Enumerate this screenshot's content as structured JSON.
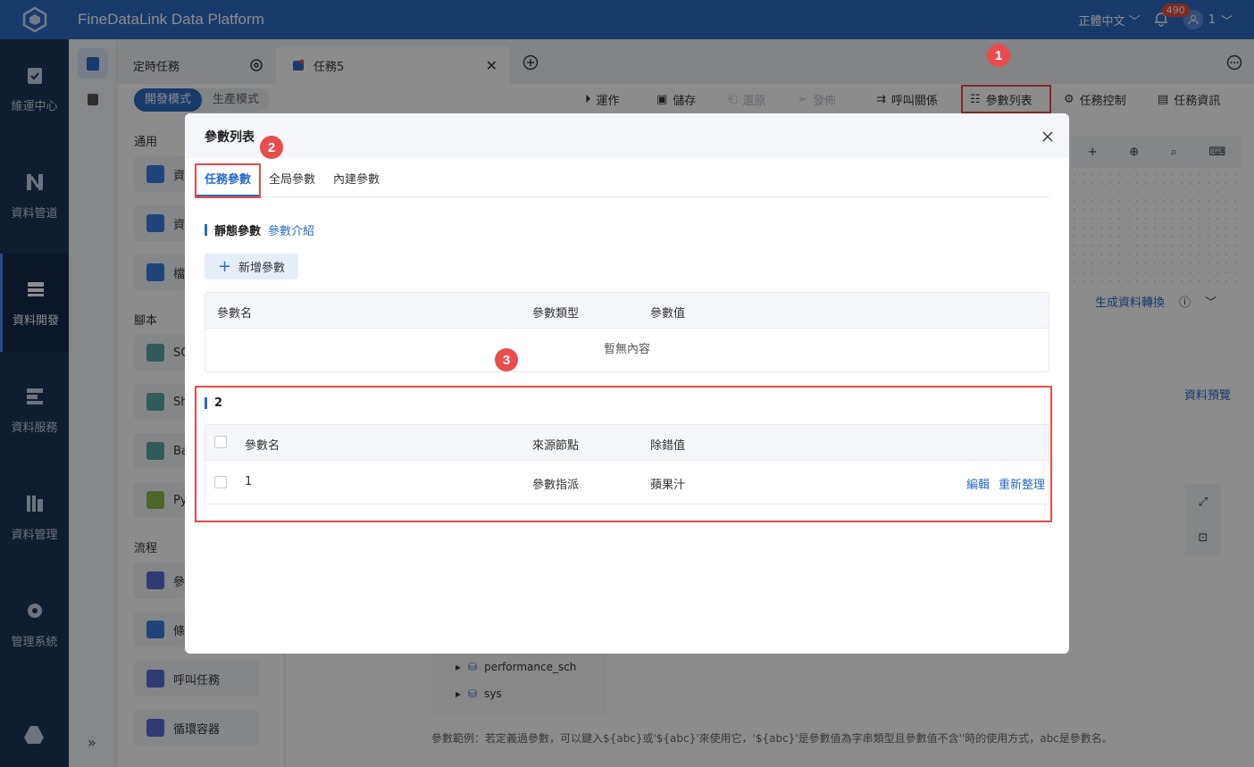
{
  "app": {
    "title": "FineDataLink Data Platform",
    "language": "正體中文",
    "notification_count": "490",
    "user": "1"
  },
  "leftnav": [
    {
      "label": "維運中心",
      "icon": "clipboard-check-icon"
    },
    {
      "label": "資料管道",
      "icon": "pipeline-icon"
    },
    {
      "label": "資料開發",
      "icon": "dev-icon"
    },
    {
      "label": "資料服務",
      "icon": "service-icon"
    },
    {
      "label": "資料管理",
      "icon": "management-icon"
    },
    {
      "label": "管理系統",
      "icon": "gear-icon"
    }
  ],
  "tabs": {
    "scheduled": "定時任務",
    "active_tab": "任務5"
  },
  "toolbar": {
    "dev_mode": "開發模式",
    "prod_mode": "生產模式",
    "run": "運作",
    "save": "儲存",
    "restore": "還原",
    "publish": "發佈",
    "call_relation": "呼叫關係",
    "param_list": "參數列表",
    "task_control": "任務控制",
    "task_info": "任務資訊"
  },
  "leftlist": {
    "group_general": "通用",
    "group_script": "腳本",
    "group_flow": "流程",
    "items": [
      {
        "label": "資",
        "icon_color": "#3b7ae0"
      },
      {
        "label": "資",
        "icon_color": "#3b7ae0"
      },
      {
        "label": "檔",
        "icon_color": "#3b7ae0"
      },
      {
        "label": "SQ",
        "icon_color": "#5aa6a0",
        "icon_text": "SQL"
      },
      {
        "label": "Sh",
        "icon_color": "#5aa6a0",
        "icon_text": "Shell"
      },
      {
        "label": "Ba",
        "icon_color": "#5aa6a0",
        "icon_text": "BAT"
      },
      {
        "label": "Py",
        "icon_color": "#8cb64e",
        "icon_text": "Python"
      },
      {
        "label": "參",
        "icon_color": "#5b6bd0"
      },
      {
        "label": "條",
        "icon_color": "#3b7ae0"
      },
      {
        "label": "呼叫任務",
        "icon_color": "#5b6bd0"
      },
      {
        "label": "循環容器",
        "icon_color": "#5b6bd0"
      }
    ]
  },
  "canvas": {
    "gen_transform": "生成資料轉換",
    "data_preview": "資料預覽",
    "tree": [
      "performance_sch",
      "sys"
    ],
    "hint": "參數範例：若定義過參數，可以鍵入${abc}或'${abc}'來使用它，'${abc}'是參數值為字串類型且參數值不含''時的使用方式，abc是參數名。"
  },
  "modal": {
    "title": "參數列表",
    "tabs": [
      "任務參數",
      "全局參數",
      "內建參數"
    ],
    "static_section": "靜態參數",
    "param_intro": "參數介紹",
    "add_param": "新增參數",
    "static_table": {
      "headers": [
        "參數名",
        "參數類型",
        "參數值"
      ],
      "empty": "暫無內容"
    },
    "dynamic_section": "2",
    "dynamic_table": {
      "headers": [
        "參數名",
        "來源節點",
        "除錯值"
      ],
      "rows": [
        {
          "name": "1",
          "source": "參數指派",
          "debug": "蘋果汁"
        }
      ],
      "edit": "編輯",
      "reorganize": "重新整理"
    }
  },
  "annotations": {
    "m1": "1",
    "m2": "2",
    "m3": "3"
  },
  "colors": {
    "brand": "#2a6bc4",
    "nav": "#1e3457",
    "annotation": "#e84c4c"
  }
}
